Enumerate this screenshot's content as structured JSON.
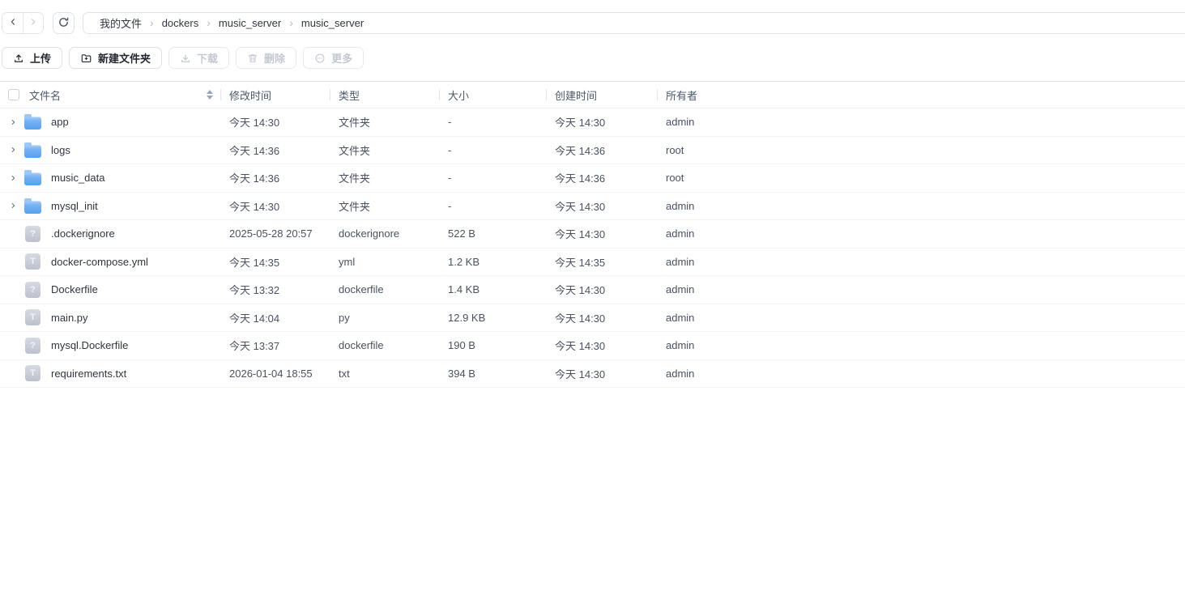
{
  "topbar": {
    "breadcrumb": [
      "我的文件",
      "dockers",
      "music_server",
      "music_server"
    ],
    "separator_glyph": "›"
  },
  "toolbar": {
    "buttons": [
      {
        "label": "上传",
        "icon": "upload-icon",
        "enabled": true
      },
      {
        "label": "新建文件夹",
        "icon": "new-folder-icon",
        "enabled": true
      },
      {
        "label": "下载",
        "icon": "download-icon",
        "enabled": false
      },
      {
        "label": "删除",
        "icon": "delete-icon",
        "enabled": false
      },
      {
        "label": "更多",
        "icon": "more-icon",
        "enabled": false
      }
    ]
  },
  "table": {
    "columns": [
      "文件名",
      "修改时间",
      "类型",
      "大小",
      "创建时间",
      "所有者"
    ],
    "icon_glyphs": {
      "file-unknown-icon": "?",
      "file-text-icon": "T"
    },
    "rows": [
      {
        "name": "app",
        "icon": "folder-icon",
        "modified": "今天 14:30",
        "type": "文件夹",
        "size": "-",
        "created": "今天 14:30",
        "owner": "admin"
      },
      {
        "name": "logs",
        "icon": "folder-icon",
        "modified": "今天 14:36",
        "type": "文件夹",
        "size": "-",
        "created": "今天 14:36",
        "owner": "root"
      },
      {
        "name": "music_data",
        "icon": "folder-icon",
        "modified": "今天 14:36",
        "type": "文件夹",
        "size": "-",
        "created": "今天 14:36",
        "owner": "root"
      },
      {
        "name": "mysql_init",
        "icon": "folder-icon",
        "modified": "今天 14:30",
        "type": "文件夹",
        "size": "-",
        "created": "今天 14:30",
        "owner": "admin"
      },
      {
        "name": ".dockerignore",
        "icon": "file-unknown-icon",
        "modified": "2025-05-28 20:57",
        "type": "dockerignore",
        "size": "522 B",
        "created": "今天 14:30",
        "owner": "admin"
      },
      {
        "name": "docker-compose.yml",
        "icon": "file-text-icon",
        "modified": "今天 14:35",
        "type": "yml",
        "size": "1.2 KB",
        "created": "今天 14:35",
        "owner": "admin"
      },
      {
        "name": "Dockerfile",
        "icon": "file-unknown-icon",
        "modified": "今天 13:32",
        "type": "dockerfile",
        "size": "1.4 KB",
        "created": "今天 14:30",
        "owner": "admin"
      },
      {
        "name": "main.py",
        "icon": "file-text-icon",
        "modified": "今天 14:04",
        "type": "py",
        "size": "12.9 KB",
        "created": "今天 14:30",
        "owner": "admin"
      },
      {
        "name": "mysql.Dockerfile",
        "icon": "file-unknown-icon",
        "modified": "今天 13:37",
        "type": "dockerfile",
        "size": "190 B",
        "created": "今天 14:30",
        "owner": "admin"
      },
      {
        "name": "requirements.txt",
        "icon": "file-text-icon",
        "modified": "2026-01-04 18:55",
        "type": "txt",
        "size": "394 B",
        "created": "今天 14:30",
        "owner": "admin"
      }
    ]
  },
  "colors": {
    "accent_folder_blue": "#55a0f0",
    "border_gray": "#dfe3e9",
    "disabled_text": "#c3c8d1",
    "primary_text": "#30353f",
    "secondary_text": "#4a5160"
  }
}
